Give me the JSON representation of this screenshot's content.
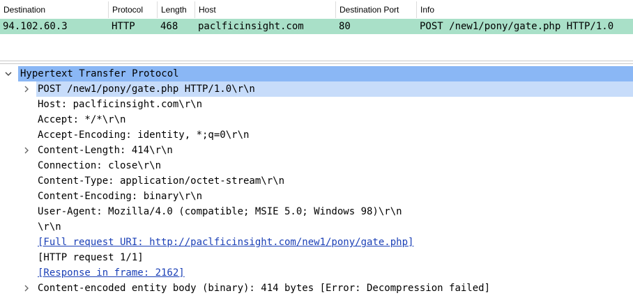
{
  "packet_list": {
    "columns": [
      "Destination",
      "Protocol",
      "Length",
      "Host",
      "Destination Port",
      "Info"
    ],
    "rows": [
      {
        "destination": "94.102.60.3",
        "protocol": "HTTP",
        "length": "468",
        "host": "paclficinsight.com",
        "destination_port": "80",
        "info": "POST /new1/pony/gate.php HTTP/1.0",
        "color": "#a9e0c8"
      }
    ]
  },
  "details": {
    "root": {
      "label": "Hypertext Transfer Protocol",
      "expanded": true,
      "selected": true
    },
    "children": [
      {
        "label": "POST /new1/pony/gate.php HTTP/1.0\\r\\n",
        "expandable": true,
        "link": false
      },
      {
        "label": "Host: paclficinsight.com\\r\\n",
        "expandable": false,
        "link": false
      },
      {
        "label": "Accept: */*\\r\\n",
        "expandable": false,
        "link": false
      },
      {
        "label": "Accept-Encoding: identity, *;q=0\\r\\n",
        "expandable": false,
        "link": false
      },
      {
        "label": "Content-Length: 414\\r\\n",
        "expandable": true,
        "link": false
      },
      {
        "label": "Connection: close\\r\\n",
        "expandable": false,
        "link": false
      },
      {
        "label": "Content-Type: application/octet-stream\\r\\n",
        "expandable": false,
        "link": false
      },
      {
        "label": "Content-Encoding: binary\\r\\n",
        "expandable": false,
        "link": false
      },
      {
        "label": "User-Agent: Mozilla/4.0 (compatible; MSIE 5.0; Windows 98)\\r\\n",
        "expandable": false,
        "link": false
      },
      {
        "label": "\\r\\n",
        "expandable": false,
        "link": false
      },
      {
        "label": "[Full request URI: http://paclficinsight.com/new1/pony/gate.php]",
        "expandable": false,
        "link": true
      },
      {
        "label": "[HTTP request 1/1]",
        "expandable": false,
        "link": false
      },
      {
        "label": "[Response in frame: 2162]",
        "expandable": false,
        "link": true
      },
      {
        "label": "Content-encoded entity body (binary): 414 bytes [Error: Decompression failed]",
        "expandable": true,
        "link": false
      }
    ]
  },
  "colors": {
    "packet_row_bg": "#a9e0c8",
    "selected_root_bg": "#8ab7f5",
    "selected_child_bg": "#c7dcfa",
    "link": "#1a3fb6"
  },
  "icons": {
    "expanded": "chevron-down-icon",
    "collapsed": "chevron-right-icon"
  }
}
